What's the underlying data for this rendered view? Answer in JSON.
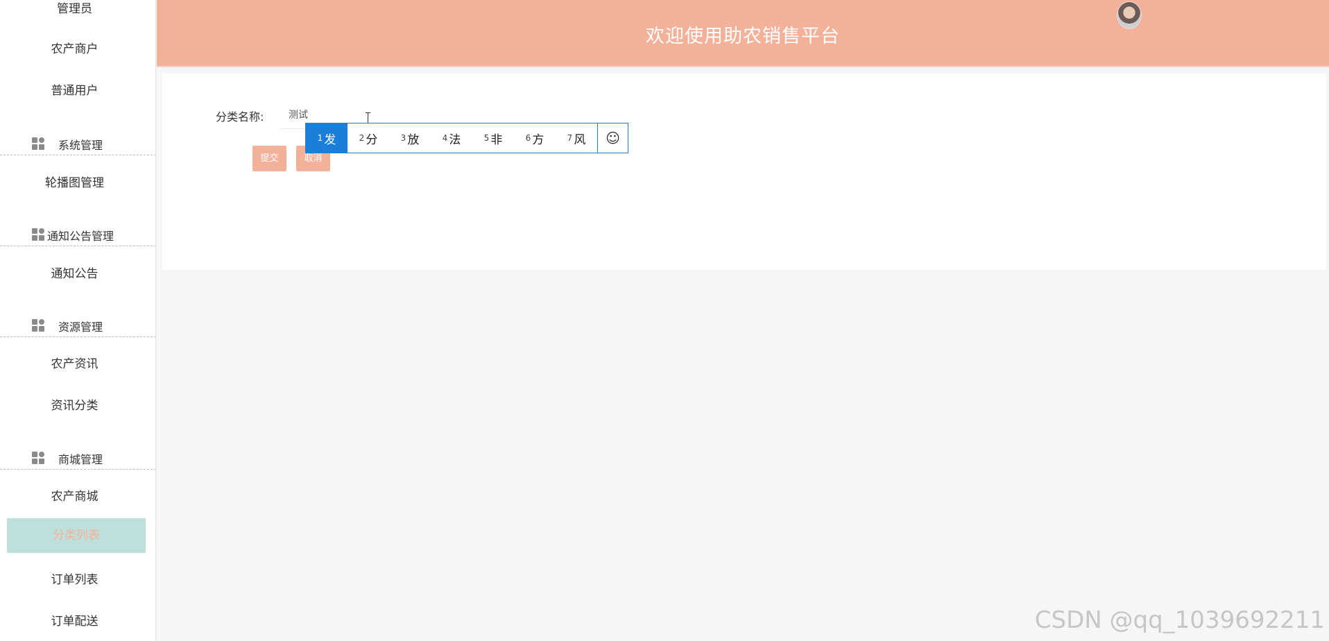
{
  "header": {
    "title": "欢迎使用助农销售平台"
  },
  "sidebar": {
    "items_top": [
      "管理员",
      "农产商户",
      "普通用户"
    ],
    "groups": [
      "系统管理",
      "通知公告管理",
      "资源管理",
      "商城管理"
    ],
    "system_items": [
      "轮播图管理"
    ],
    "notice_items": [
      "通知公告"
    ],
    "resource_items": [
      "农产资讯",
      "资讯分类"
    ],
    "mall_items": [
      "农产商城",
      "分类列表",
      "订单列表",
      "订单配送"
    ]
  },
  "form": {
    "label": "分类名称:",
    "input_value": "测试",
    "submit": "提交",
    "cancel": "取消"
  },
  "ime": {
    "candidates": [
      {
        "num": "1",
        "char": "发"
      },
      {
        "num": "2",
        "char": "分"
      },
      {
        "num": "3",
        "char": "放"
      },
      {
        "num": "4",
        "char": "法"
      },
      {
        "num": "5",
        "char": "非"
      },
      {
        "num": "6",
        "char": "方"
      },
      {
        "num": "7",
        "char": "风"
      }
    ],
    "emoji_icon": "smiley-icon",
    "emoji_glyph": "☺"
  },
  "watermark": "CSDN @qq_1039692211"
}
